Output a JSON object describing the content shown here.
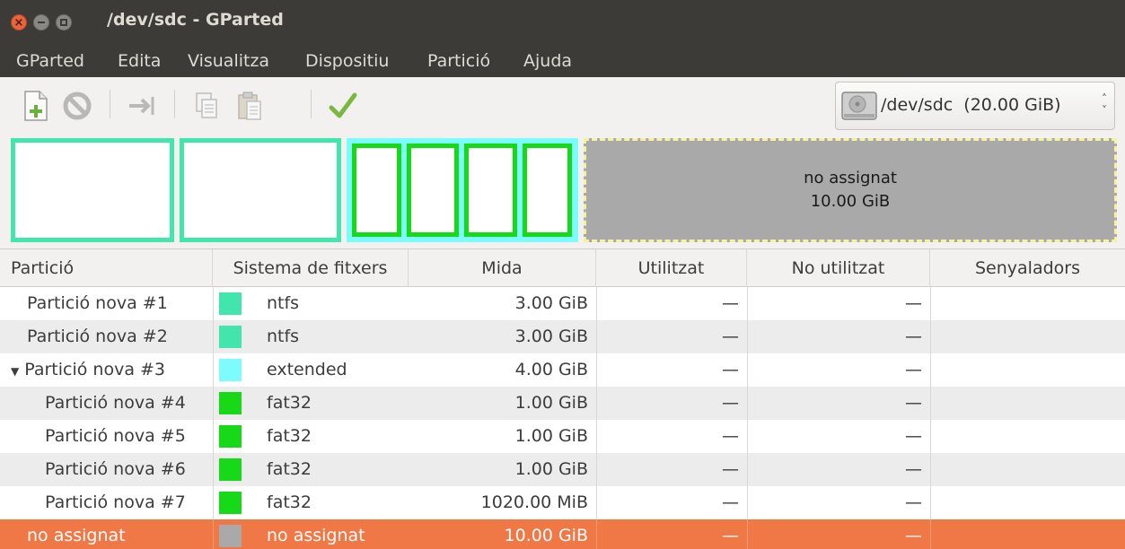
{
  "window": {
    "title": "/dev/sdc - GParted"
  },
  "menu": [
    "GParted",
    "Edita",
    "Visualitza",
    "Dispositiu",
    "Partició",
    "Ajuda"
  ],
  "toolbar": {
    "icons": [
      "new-partition-icon",
      "delete-icon",
      "resize-move-icon",
      "copy-icon",
      "paste-icon",
      "apply-icon"
    ]
  },
  "device_selector": {
    "label": "/dev/sdc  (20.00 GiB)"
  },
  "disk_map": {
    "unallocated_label": "no assignat",
    "unallocated_size": "10.00 GiB"
  },
  "colors": {
    "ntfs": "#42e5ac",
    "extended": "#7dfcfe",
    "fat32": "#18d918",
    "unallocated": "#a9a9a9",
    "selection": "#f07746"
  },
  "table": {
    "headers": [
      "Partició",
      "Sistema de fitxers",
      "Mida",
      "Utilitzat",
      "No utilitzat",
      "Senyaladors"
    ],
    "rows": [
      {
        "name": "Partició nova #1",
        "fs": "ntfs",
        "size": "3.00 GiB",
        "used": "—",
        "unused": "—",
        "flags": "",
        "color": "#42e5ac"
      },
      {
        "name": "Partició nova #2",
        "fs": "ntfs",
        "size": "3.00 GiB",
        "used": "—",
        "unused": "—",
        "flags": "",
        "color": "#42e5ac"
      },
      {
        "name": "Partició nova #3",
        "fs": "extended",
        "size": "4.00 GiB",
        "used": "—",
        "unused": "—",
        "flags": "",
        "color": "#7dfcfe"
      },
      {
        "name": "Partició nova #4",
        "fs": "fat32",
        "size": "1.00 GiB",
        "used": "—",
        "unused": "—",
        "flags": "",
        "color": "#18d918"
      },
      {
        "name": "Partició nova #5",
        "fs": "fat32",
        "size": "1.00 GiB",
        "used": "—",
        "unused": "—",
        "flags": "",
        "color": "#18d918"
      },
      {
        "name": "Partició nova #6",
        "fs": "fat32",
        "size": "1.00 GiB",
        "used": "—",
        "unused": "—",
        "flags": "",
        "color": "#18d918"
      },
      {
        "name": "Partició nova #7",
        "fs": "fat32",
        "size": "1020.00 MiB",
        "used": "—",
        "unused": "—",
        "flags": "",
        "color": "#18d918"
      },
      {
        "name": "no assignat",
        "fs": "no assignat",
        "size": "10.00 GiB",
        "used": "—",
        "unused": "—",
        "flags": "",
        "color": "#a9a9a9"
      }
    ]
  }
}
